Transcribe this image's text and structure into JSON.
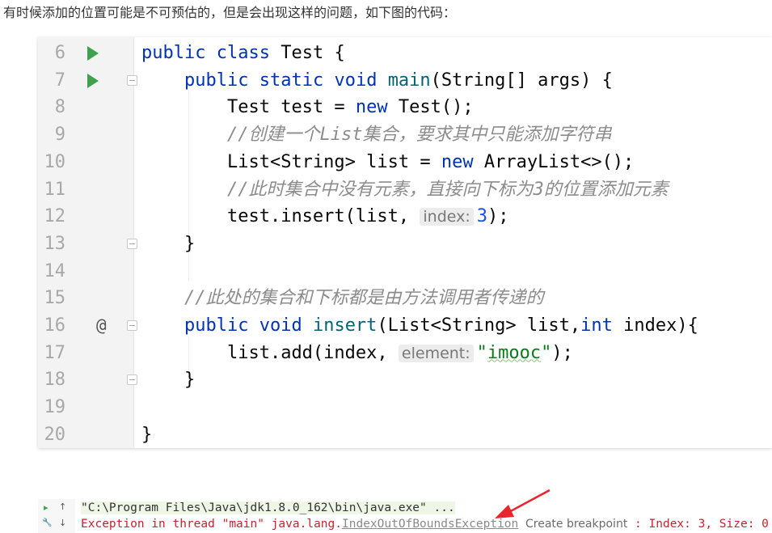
{
  "intro_text": "有时候添加的位置可能是不可预估的，但是会出现这样的问题，如下图的代码：",
  "editor": {
    "lines": [
      {
        "n": "6",
        "run": true,
        "at": false,
        "fold": false
      },
      {
        "n": "7",
        "run": true,
        "at": false,
        "fold": true
      },
      {
        "n": "8",
        "run": false,
        "at": false,
        "fold": false
      },
      {
        "n": "9",
        "run": false,
        "at": false,
        "fold": false
      },
      {
        "n": "10",
        "run": false,
        "at": false,
        "fold": false
      },
      {
        "n": "11",
        "run": false,
        "at": false,
        "fold": false
      },
      {
        "n": "12",
        "run": false,
        "at": false,
        "fold": false
      },
      {
        "n": "13",
        "run": false,
        "at": false,
        "fold": true
      },
      {
        "n": "14",
        "run": false,
        "at": false,
        "fold": false
      },
      {
        "n": "15",
        "run": false,
        "at": false,
        "fold": false
      },
      {
        "n": "16",
        "run": false,
        "at": true,
        "fold": true
      },
      {
        "n": "17",
        "run": false,
        "at": false,
        "fold": false
      },
      {
        "n": "18",
        "run": false,
        "at": false,
        "fold": true
      },
      {
        "n": "19",
        "run": false,
        "at": false,
        "fold": false
      },
      {
        "n": "20",
        "run": false,
        "at": false,
        "fold": false
      }
    ],
    "at_symbol": "@",
    "code": {
      "l6": {
        "kw1": "public",
        "kw2": "class",
        "rest": " Test {"
      },
      "l7": {
        "kw1": "public",
        "kw2": "static",
        "kw3": "void",
        "fn": "main",
        "rest": "(String[] args) {"
      },
      "l8": {
        "a": "Test test = ",
        "kw": "new",
        "b": " Test();"
      },
      "l9": {
        "comment": "//创建一个List集合，要求其中只能添加字符串"
      },
      "l10": {
        "a": "List<String> list = ",
        "kw": "new",
        "b": " ArrayList<>();"
      },
      "l11": {
        "comment": "//此时集合中没有元素，直接向下标为3的位置添加元素"
      },
      "l12": {
        "a": "test.insert(list,",
        "hint": "index:",
        "num": "3",
        "b": ");"
      },
      "l13": {
        "a": "}"
      },
      "l15": {
        "comment": "//此处的集合和下标都是由方法调用者传递的"
      },
      "l16": {
        "kw1": "public",
        "kw2": "void",
        "fn": "insert",
        "a": "(List<String> list,",
        "kw3": "int",
        "b": " index){"
      },
      "l17": {
        "a": "list.add(index,",
        "hint": "element:",
        "str_q1": "\"",
        "str": "imooc",
        "str_q2": "\"",
        "b": ");"
      },
      "l18": {
        "a": "}"
      },
      "l20": {
        "a": "}"
      }
    }
  },
  "console": {
    "icons": {
      "run": "▸",
      "up": "↑",
      "wrench": "🔧",
      "down": "↓"
    },
    "command": "\"C:\\Program Files\\Java\\jdk1.8.0_162\\bin\\java.exe\" ...",
    "error_prefix": "Exception in thread \"main\" java.lang.",
    "exception_name": "IndexOutOfBoundsException",
    "breakpoint_label": "Create breakpoint",
    "error_suffix": " : Index: 3, Size: 0"
  }
}
